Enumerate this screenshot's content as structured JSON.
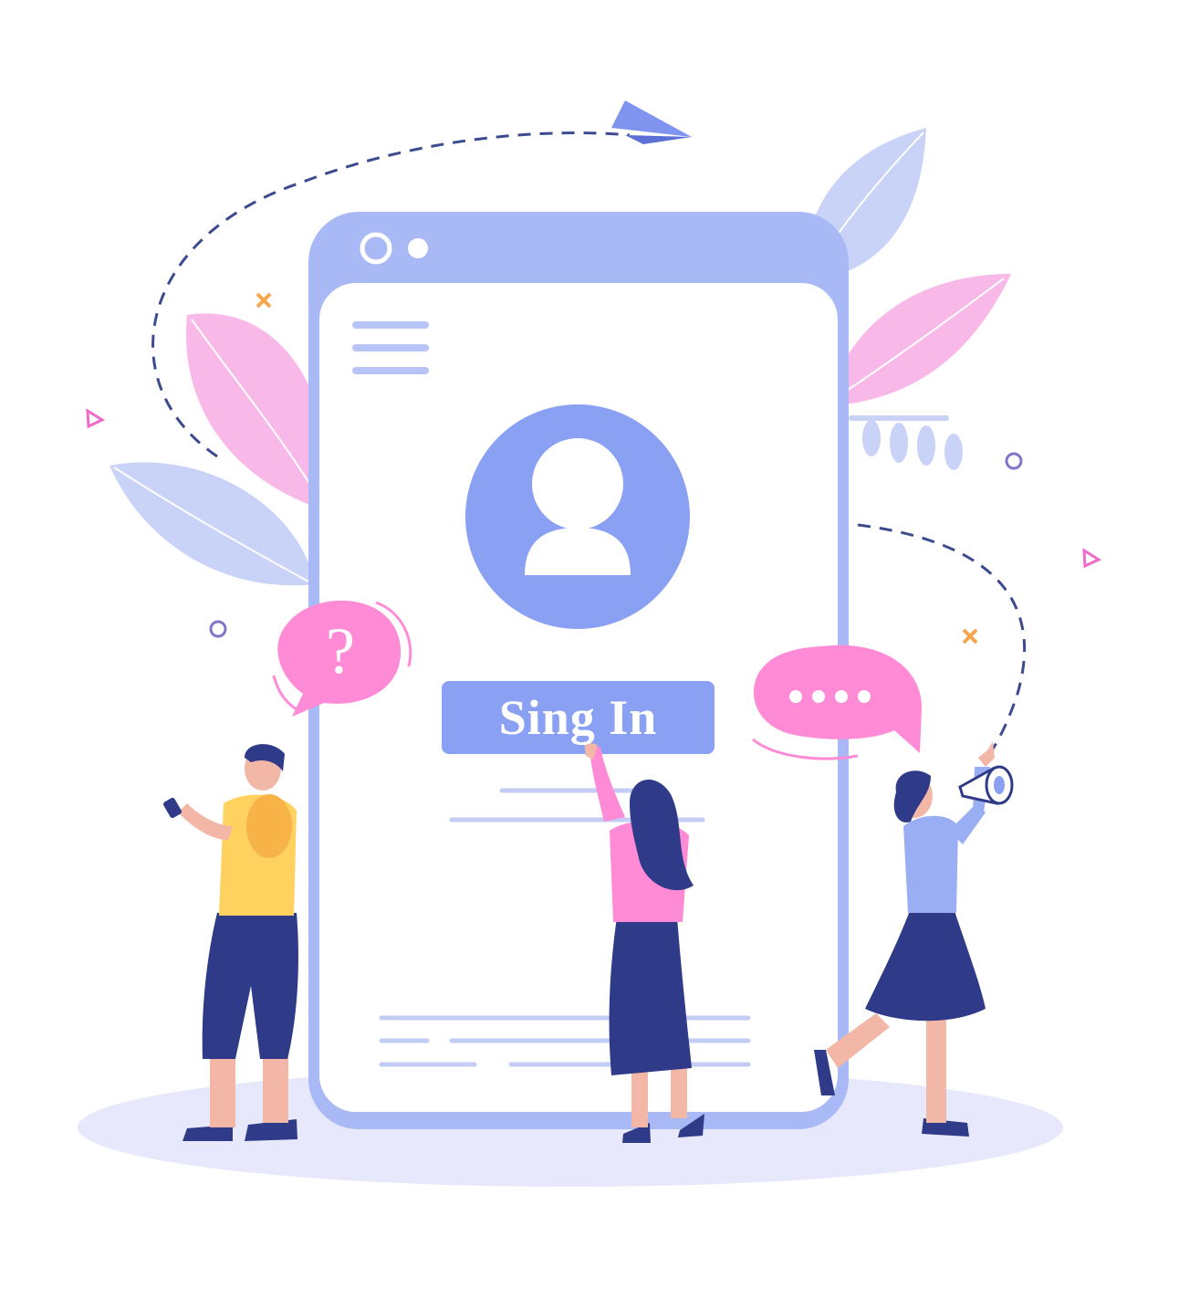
{
  "signin": {
    "label": "Sing In"
  },
  "question_bubble": {
    "mark": "?"
  },
  "colors": {
    "phone_frame": "#a9b9f5",
    "accent_blue": "#8aa0f2",
    "pink": "#ff8ad6",
    "leaf_pink": "#f9b9e8",
    "leaf_blue": "#c9d2f7",
    "navy": "#2f3b88",
    "orange": "#f7a64a",
    "ground": "#e7e8fb"
  },
  "icons": [
    "paper-plane-icon",
    "user-avatar-icon",
    "megaphone-icon",
    "question-bubble-icon",
    "typing-bubble-icon"
  ]
}
